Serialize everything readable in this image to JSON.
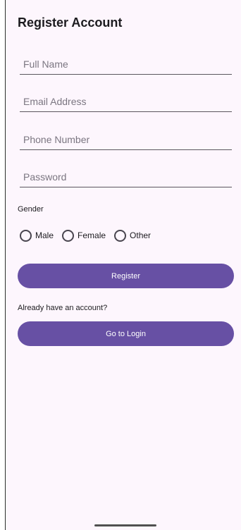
{
  "header": {
    "title": "Register Account"
  },
  "form": {
    "full_name": {
      "value": "",
      "placeholder": "Full Name"
    },
    "email": {
      "value": "",
      "placeholder": "Email Address"
    },
    "phone": {
      "value": "",
      "placeholder": "Phone Number"
    },
    "password": {
      "value": "",
      "placeholder": "Password"
    },
    "gender": {
      "label": "Gender",
      "options": [
        {
          "label": "Male",
          "selected": false
        },
        {
          "label": "Female",
          "selected": false
        },
        {
          "label": "Other",
          "selected": false
        }
      ]
    }
  },
  "actions": {
    "register_label": "Register",
    "login_prompt": "Already have an account?",
    "login_label": "Go to Login"
  },
  "colors": {
    "primary": "#6750a4",
    "background": "#fdf6fd",
    "text": "#1c1b1f",
    "placeholder": "#7b7681"
  }
}
